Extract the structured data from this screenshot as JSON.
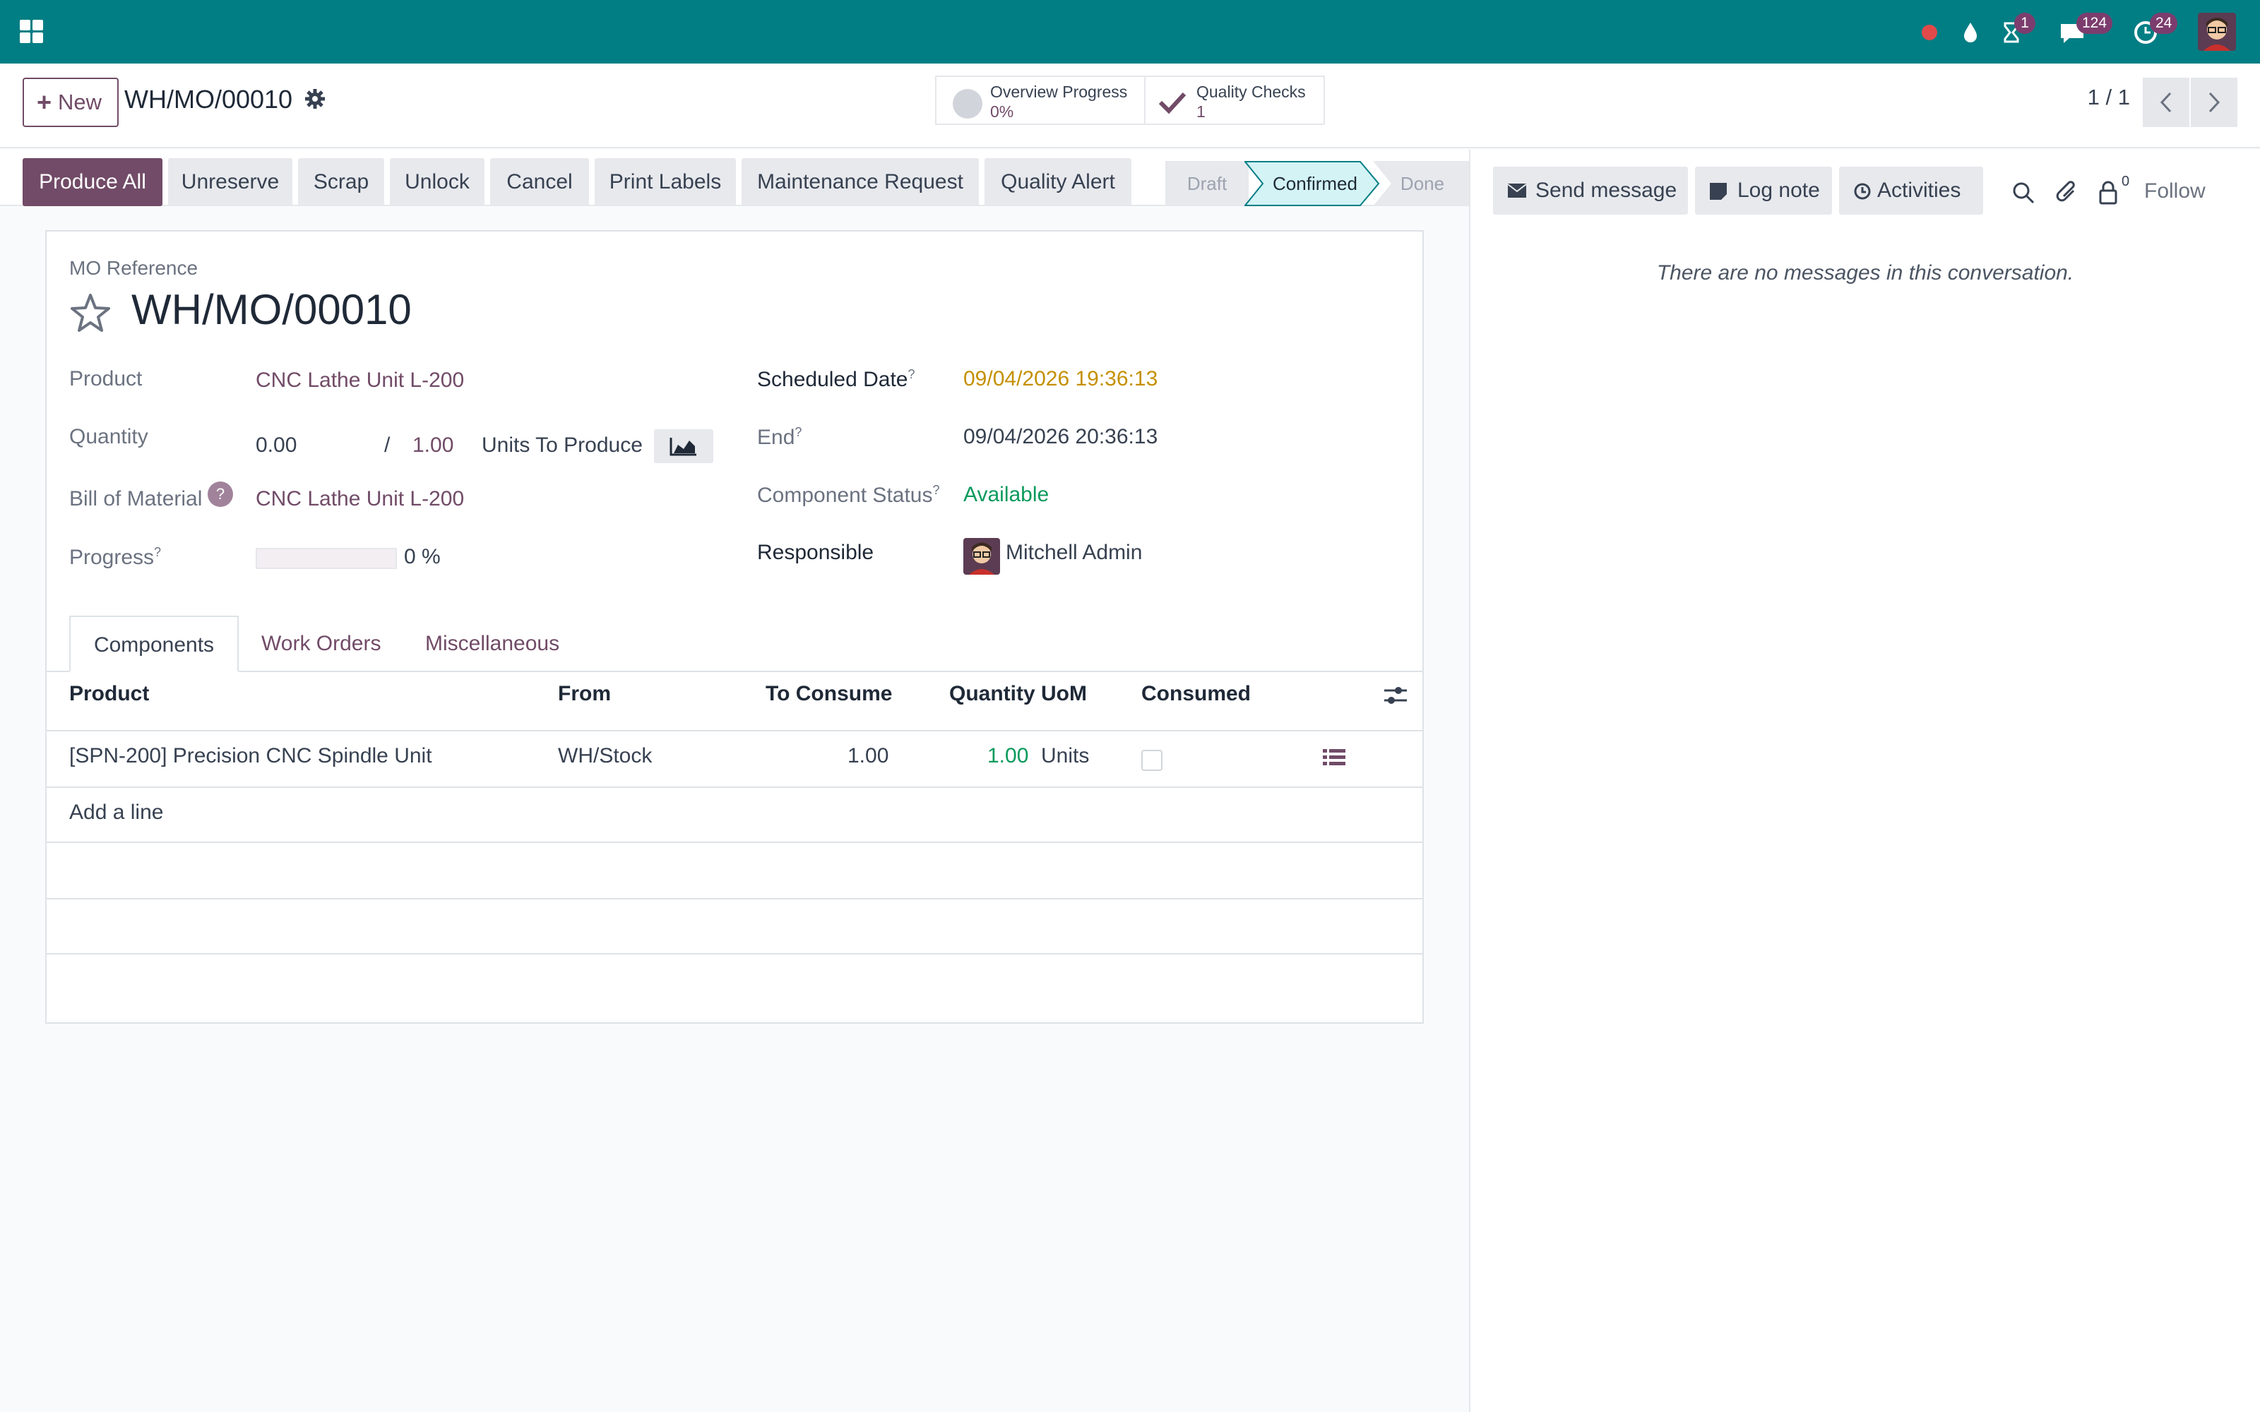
{
  "topbar": {
    "activity_badge": "1",
    "messages_badge": "124",
    "clock_badge": "24",
    "icons": [
      "apps-icon",
      "record-icon",
      "drop-icon",
      "hourglass-icon",
      "chat-icon",
      "clock-icon",
      "avatar"
    ]
  },
  "control_panel": {
    "new_label": "New",
    "breadcrumb": "WH/MO/00010",
    "overview_label": "Overview Progress",
    "overview_value": "0%",
    "quality_label": "Quality Checks",
    "quality_value": "1",
    "pager": "1 / 1"
  },
  "status_buttons": [
    "Produce All",
    "Unreserve",
    "Scrap",
    "Unlock",
    "Cancel",
    "Print Labels",
    "Maintenance Request",
    "Quality Alert"
  ],
  "stages": {
    "items": [
      "Draft",
      "Confirmed",
      "Done"
    ],
    "active": "Confirmed"
  },
  "form": {
    "ref_label": "MO Reference",
    "ref_value": "WH/MO/00010",
    "product_label": "Product",
    "product_value": "CNC Lathe Unit L-200",
    "quantity_label": "Quantity",
    "qty_produced": "0.00",
    "qty_sep": "/",
    "qty_target": "1.00",
    "qty_unit": "Units To Produce",
    "bom_label": "Bill of Material",
    "bom_help": "?",
    "bom_value": "CNC Lathe Unit L-200",
    "progress_label": "Progress",
    "progress_text": "0 %",
    "progress_fraction": 0,
    "sched_label": "Scheduled Date",
    "sched_value": "09/04/2026 19:36:13",
    "end_label": "End",
    "end_value": "09/04/2026 20:36:13",
    "comp_status_label": "Component Status",
    "comp_status_value": "Available",
    "responsible_label": "Responsible",
    "responsible_value": "Mitchell Admin",
    "help_mark": "?"
  },
  "tabs": [
    "Components",
    "Work Orders",
    "Miscellaneous"
  ],
  "components": {
    "headers": [
      "Product",
      "From",
      "To Consume",
      "Quantity",
      "UoM",
      "Consumed"
    ],
    "rows": [
      {
        "product": "[SPN-200] Precision CNC Spindle Unit",
        "from": "WH/Stock",
        "to_consume": "1.00",
        "quantity": "1.00",
        "uom": "Units"
      }
    ],
    "add_line": "Add a line"
  },
  "chatter": {
    "send_message": "Send message",
    "log_note": "Log note",
    "activities": "Activities",
    "followers_count": "0",
    "follow": "Follow",
    "empty_text": "There are no messages in this conversation."
  },
  "colors": {
    "topbar": "#017e84",
    "primary": "#714b67",
    "warning": "#c49000",
    "success": "#0a9a5c"
  }
}
